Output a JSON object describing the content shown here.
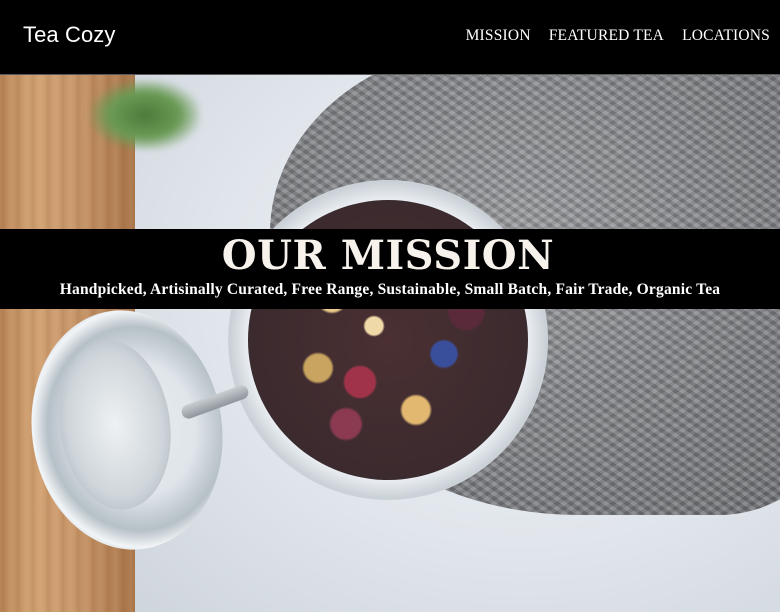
{
  "header": {
    "logo": "Tea Cozy",
    "nav": [
      "MISSION",
      "FEATURED TEA",
      "LOCATIONS"
    ]
  },
  "mission": {
    "title": "OUR MISSION",
    "subtitle": "Handpicked, Artisinally Curated, Free Range, Sustainable, Small Batch, Fair Trade, Organic Tea"
  },
  "colors": {
    "header_bg": "#000000",
    "banner_bg": "#000000",
    "text": "#ffffff",
    "title_text": "#f7f2ec"
  }
}
